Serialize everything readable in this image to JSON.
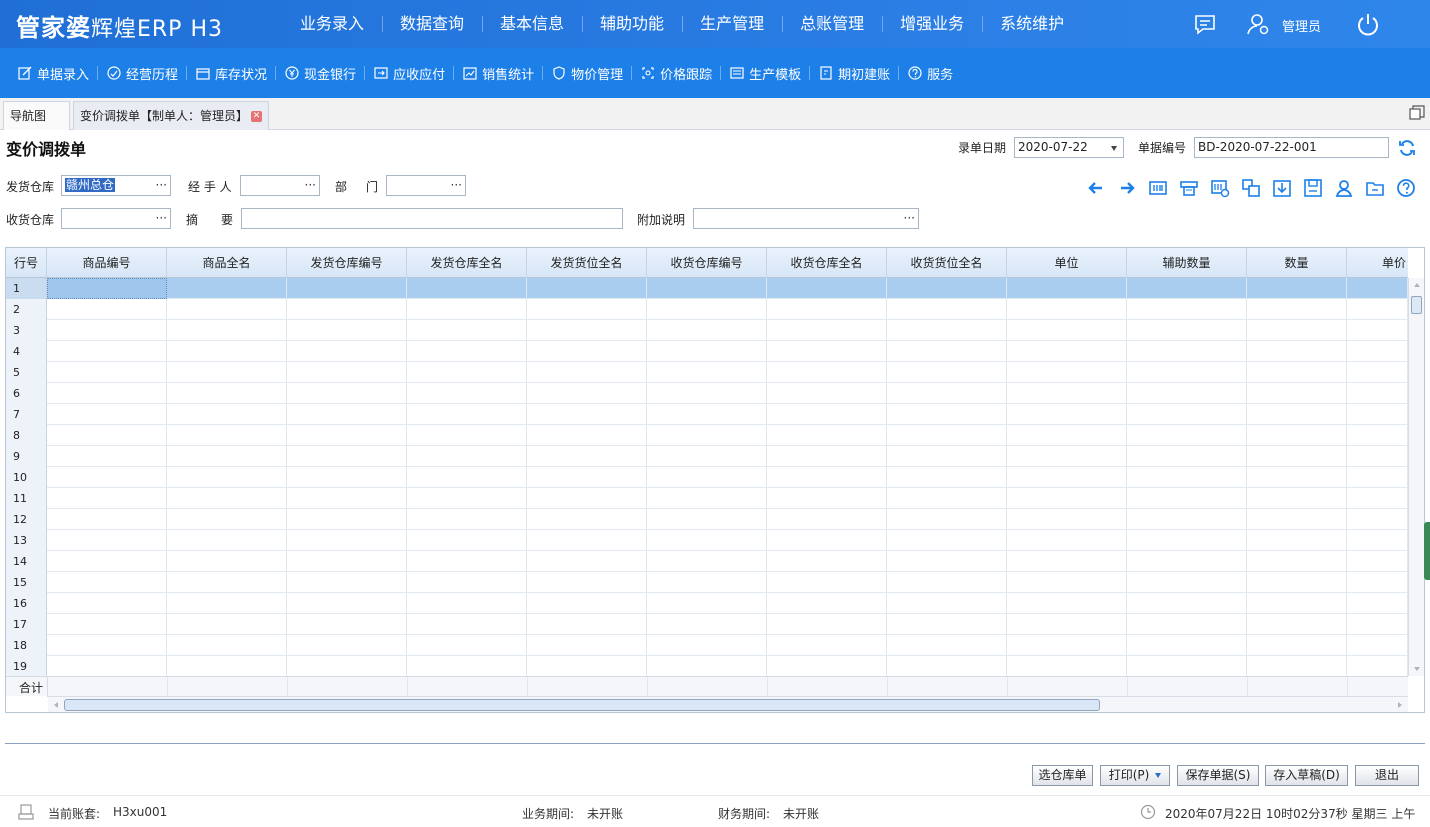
{
  "app": {
    "logo_main": "管家婆",
    "logo_sub": "辉煌ERP H3",
    "user": "管理员"
  },
  "main_nav": [
    "业务录入",
    "数据查询",
    "基本信息",
    "辅助功能",
    "生产管理",
    "总账管理",
    "增强业务",
    "系统维护"
  ],
  "sub_nav": [
    {
      "label": "单据录入",
      "icon": "edit-icon"
    },
    {
      "label": "经营历程",
      "icon": "history-icon"
    },
    {
      "label": "库存状况",
      "icon": "inventory-icon"
    },
    {
      "label": "现金银行",
      "icon": "yen-icon"
    },
    {
      "label": "应收应付",
      "icon": "receivable-icon"
    },
    {
      "label": "销售统计",
      "icon": "chart-icon"
    },
    {
      "label": "物价管理",
      "icon": "shield-icon"
    },
    {
      "label": "价格跟踪",
      "icon": "track-icon"
    },
    {
      "label": "生产模板",
      "icon": "template-icon"
    },
    {
      "label": "期初建账",
      "icon": "ledger-icon"
    },
    {
      "label": "服务",
      "icon": "help-icon"
    }
  ],
  "tabs": {
    "nav": "导航图",
    "active": "变价调拨单【制单人：管理员】"
  },
  "form": {
    "title": "变价调拨单",
    "date_label": "录单日期",
    "date_value": "2020-07-22",
    "number_label": "单据编号",
    "number_value": "BD-2020-07-22-001",
    "out_wh_label": "发货仓库",
    "out_wh_value": "赣州总仓",
    "handler_label": "经 手 人",
    "handler_value": "",
    "dept_label1": "部",
    "dept_label2": "门",
    "dept_value": "",
    "in_wh_label": "收货仓库",
    "in_wh_value": "",
    "summary_label1": "摘",
    "summary_label2": "要",
    "summary_value": "",
    "note_label": "附加说明",
    "note_value": "",
    "dots": "···"
  },
  "grid": {
    "row_header": "行号",
    "columns": [
      "商品编号",
      "商品全名",
      "发货仓库编号",
      "发货仓库全名",
      "发货货位全名",
      "收货仓库编号",
      "收货仓库全名",
      "收货货位全名",
      "单位",
      "辅助数量",
      "数量",
      "单价"
    ],
    "rows": [
      "1",
      "2",
      "3",
      "4",
      "5",
      "6",
      "7",
      "8",
      "9",
      "10",
      "11",
      "12",
      "13",
      "14",
      "15",
      "16",
      "17",
      "18",
      "19"
    ],
    "total_label": "合计"
  },
  "buttons": {
    "select_wh": "选仓库单",
    "print": "打印(P)",
    "save": "保存单据(S)",
    "draft": "存入草稿(D)",
    "exit": "退出"
  },
  "status": {
    "account_label": "当前账套:",
    "account_value": "H3xu001",
    "biz_period_label": "业务期间:",
    "biz_period_value": "未开账",
    "fin_period_label": "财务期间:",
    "fin_period_value": "未开账",
    "datetime": "2020年07月22日 10时02分37秒 星期三 上午"
  },
  "colors": {
    "topbar": "#2a7de4",
    "subbar": "#1d80e8",
    "accent": "#1d80e8",
    "row_highlight": "#a9cdef"
  }
}
